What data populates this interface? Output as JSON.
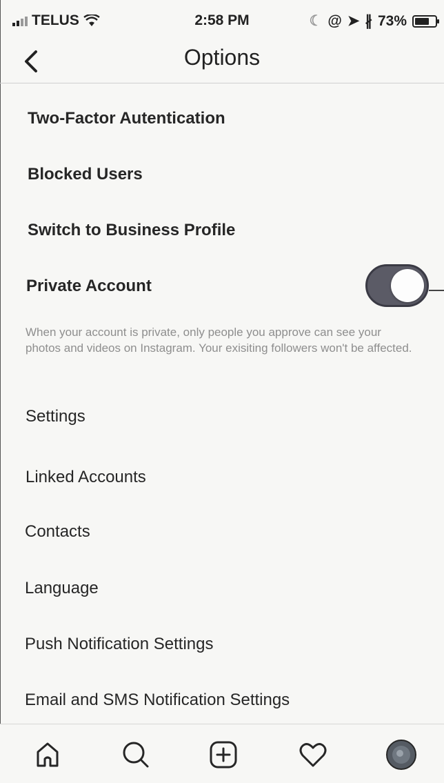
{
  "status_bar": {
    "carrier": "TELUS",
    "time": "2:58 PM",
    "battery_percent": "73%",
    "battery_level": 0.73
  },
  "nav": {
    "title": "Options",
    "back_icon": "chevron-left-icon"
  },
  "account_items": [
    {
      "label": "Two-Factor Autentication"
    },
    {
      "label": "Blocked Users"
    },
    {
      "label": "Switch to Business Profile"
    }
  ],
  "private_account": {
    "label": "Private Account",
    "enabled": true,
    "note": "When your account is private, only people you approve can see your photos and videos on Instagram. Your exisiting followers won't be affected."
  },
  "settings": {
    "header": "Settings",
    "items": [
      {
        "label": "Linked Accounts"
      },
      {
        "label": "Contacts"
      },
      {
        "label": "Language"
      },
      {
        "label": "Push Notification Settings"
      },
      {
        "label": "Email and SMS Notification Settings"
      }
    ]
  },
  "chevron": "›",
  "tab_bar": {
    "icons": [
      "home-icon",
      "search-icon",
      "add-post-icon",
      "heart-icon",
      "profile-avatar-icon"
    ]
  },
  "colors": {
    "toggle_on": "#5b5b66",
    "text": "#262626",
    "muted": "#8e8e8e"
  }
}
